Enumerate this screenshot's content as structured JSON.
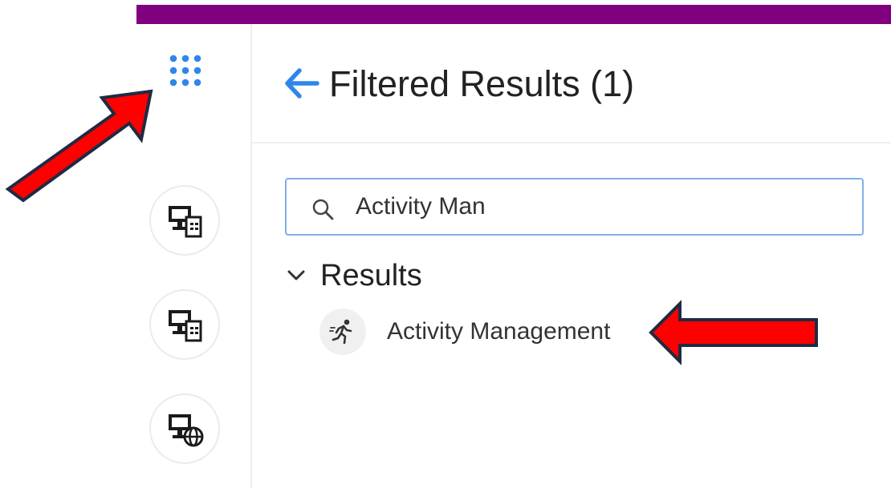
{
  "colors": {
    "top_bar": "#800080",
    "accent_blue": "#2f86e8",
    "annotation_red": "#ff0000",
    "annotation_outline": "#1f2a44"
  },
  "header": {
    "back_icon": "arrow-left-icon",
    "title": "Filtered Results (1)"
  },
  "rail": {
    "launcher_icon": "app-launcher-grid-icon",
    "items": [
      {
        "icon": "monitor-document-icon"
      },
      {
        "icon": "monitor-document-icon"
      },
      {
        "icon": "monitor-globe-icon"
      }
    ]
  },
  "search": {
    "icon": "search-icon",
    "value": "Activity Man"
  },
  "results": {
    "section_label": "Results",
    "expanded": true,
    "items": [
      {
        "label": "Activity Management",
        "icon": "running-person-icon"
      }
    ]
  }
}
